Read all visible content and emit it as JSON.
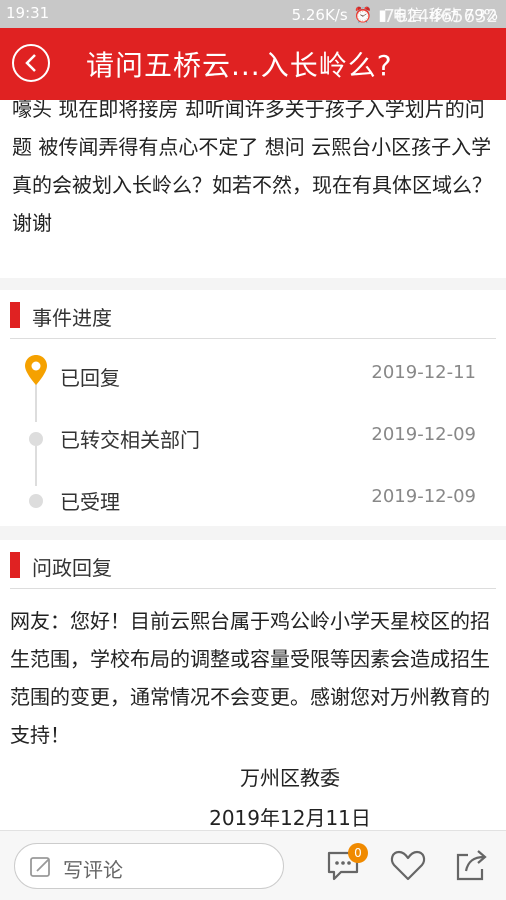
{
  "status_bar": {
    "time": "19:31",
    "network_speed": "5.26K/s",
    "carrier1": "电信",
    "carrier2": "移动",
    "battery": "79%",
    "watermark": "7624465632"
  },
  "header": {
    "title": "请问五桥云...入长岭么?"
  },
  "question": {
    "text": "嚎头 现在即将接房 却听闻许多关于孩子入学划片的问题 被传闻弄得有点心不定了 想问 云熙台小区孩子入学真的会被划入长岭么？如若不然，现在有具体区域么？谢谢"
  },
  "progress": {
    "title": "事件进度",
    "items": [
      {
        "label": "已回复",
        "date": "2019-12-11"
      },
      {
        "label": "已转交相关部门",
        "date": "2019-12-09"
      },
      {
        "label": "已受理",
        "date": "2019-12-09"
      }
    ]
  },
  "reply": {
    "title": "问政回复",
    "body": "网友：您好！目前云熙台属于鸡公岭小学天星校区的招生范围，学校布局的调整或容量受限等因素会造成招生范围的变更，通常情况不会变更。感谢您对万州教育的支持！",
    "signer": "万州区教委",
    "date": "2019年12月11日"
  },
  "bottom_bar": {
    "comment_placeholder": "写评论",
    "comment_count": "0"
  },
  "colors": {
    "accent": "#e02222",
    "badge": "#f08a00",
    "pin": "#f5a100"
  }
}
